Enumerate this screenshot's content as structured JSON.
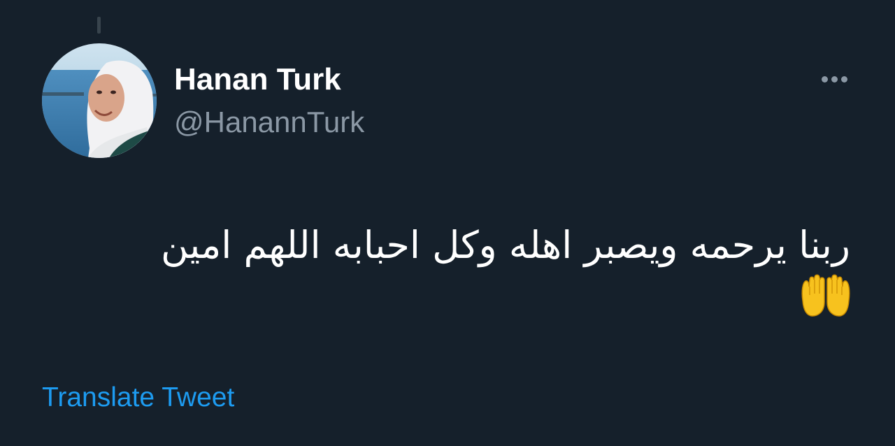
{
  "tweet": {
    "author": {
      "display_name": "Hanan Turk",
      "handle": "@HanannTurk",
      "avatar_icon": "profile-photo"
    },
    "text": "ربنا يرحمه ويصبر اهله وكل احبابه اللهم امين",
    "emoji": "🤲",
    "more_icon": "ellipsis-icon",
    "translate_label": "Translate Tweet"
  },
  "colors": {
    "background": "#15202b",
    "primary_text": "#ffffff",
    "secondary_text": "#8b98a5",
    "link": "#1d9bf0"
  }
}
